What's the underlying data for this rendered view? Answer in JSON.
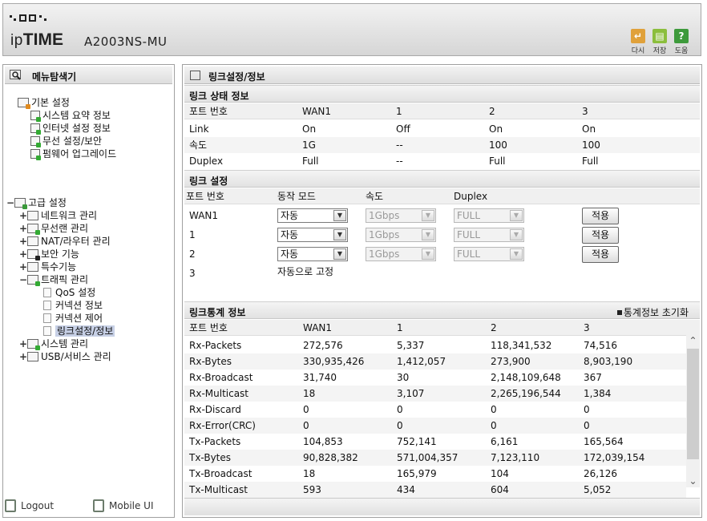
{
  "header": {
    "brand_prefix": "ip",
    "brand_main": "TIME",
    "model": "A2003NS-MU",
    "buttons": [
      {
        "label": "다시",
        "icon": "restart-icon",
        "color": "#e0a13a"
      },
      {
        "label": "저장",
        "icon": "save-icon",
        "color": "#8bbe3c"
      },
      {
        "label": "도움",
        "icon": "help-icon",
        "color": "#3d9a3b"
      }
    ]
  },
  "sidebar": {
    "title": "메뉴탐색기",
    "basic": {
      "label": "기본 설정",
      "items": [
        "시스템 요약 정보",
        "인터넷 설정 정보",
        "무선 설정/보안",
        "펌웨어 업그레이드"
      ]
    },
    "advanced": {
      "toggle": "−",
      "label": "고급 설정",
      "items": [
        {
          "toggle": "+",
          "label": "네트워크 관리"
        },
        {
          "toggle": "+",
          "label": "무선랜 관리"
        },
        {
          "toggle": "+",
          "label": "NAT/라우터 관리"
        },
        {
          "toggle": "+",
          "label": "보안 기능"
        },
        {
          "toggle": "+",
          "label": "특수기능"
        },
        {
          "toggle": "−",
          "label": "트래픽 관리"
        },
        {
          "toggle": "",
          "label": "QoS 설정"
        },
        {
          "toggle": "",
          "label": "커넥션 정보"
        },
        {
          "toggle": "",
          "label": "커넥션 제어"
        },
        {
          "toggle": "",
          "label": "링크설정/정보"
        },
        {
          "toggle": "+",
          "label": "시스템 관리"
        },
        {
          "toggle": "+",
          "label": "USB/서비스 관리"
        }
      ]
    },
    "footer": {
      "logout": "Logout",
      "mobile": "Mobile UI"
    }
  },
  "main": {
    "title": "링크설정/정보",
    "link_status": {
      "title": "링크 상태 정보",
      "headers": [
        "포트 번호",
        "WAN1",
        "1",
        "2",
        "3"
      ],
      "rows": [
        [
          "Link",
          "On",
          "Off",
          "On",
          "On"
        ],
        [
          "속도",
          "1G",
          "--",
          "100",
          "100"
        ],
        [
          "Duplex",
          "Full",
          "--",
          "Full",
          "Full"
        ]
      ]
    },
    "link_config": {
      "title": "링크 설정",
      "headers": [
        "포트 번호",
        "동작 모드",
        "속도",
        "Duplex"
      ],
      "rows": [
        {
          "port": "WAN1",
          "mode": "자동",
          "speed": "1Gbps",
          "duplex": "FULL",
          "apply": "적용"
        },
        {
          "port": "1",
          "mode": "자동",
          "speed": "1Gbps",
          "duplex": "FULL",
          "apply": "적용"
        },
        {
          "port": "2",
          "mode": "자동",
          "speed": "1Gbps",
          "duplex": "FULL",
          "apply": "적용"
        }
      ],
      "fixed_port": "3",
      "fixed_text": "자동으로 고정"
    },
    "link_stats": {
      "title": "링크통계 정보",
      "reset": "통계정보 초기화",
      "headers": [
        "포트 번호",
        "WAN1",
        "1",
        "2",
        "3"
      ],
      "rows": [
        [
          "Rx-Packets",
          "272,576",
          "5,337",
          "118,341,532",
          "74,516"
        ],
        [
          "Rx-Bytes",
          "330,935,426",
          "1,412,057",
          "273,900",
          "8,903,190"
        ],
        [
          "Rx-Broadcast",
          "31,740",
          "30",
          "2,148,109,648",
          "367"
        ],
        [
          "Rx-Multicast",
          "18",
          "3,107",
          "2,265,196,544",
          "1,384"
        ],
        [
          "Rx-Discard",
          "0",
          "0",
          "0",
          "0"
        ],
        [
          "Rx-Error(CRC)",
          "0",
          "0",
          "0",
          "0"
        ],
        [
          "Tx-Packets",
          "104,853",
          "752,141",
          "6,161",
          "165,564"
        ],
        [
          "Tx-Bytes",
          "90,828,382",
          "571,004,357",
          "7,123,110",
          "172,039,154"
        ],
        [
          "Tx-Broadcast",
          "18",
          "165,979",
          "104",
          "26,126"
        ],
        [
          "Tx-Multicast",
          "593",
          "434",
          "604",
          "5,052"
        ]
      ]
    }
  }
}
